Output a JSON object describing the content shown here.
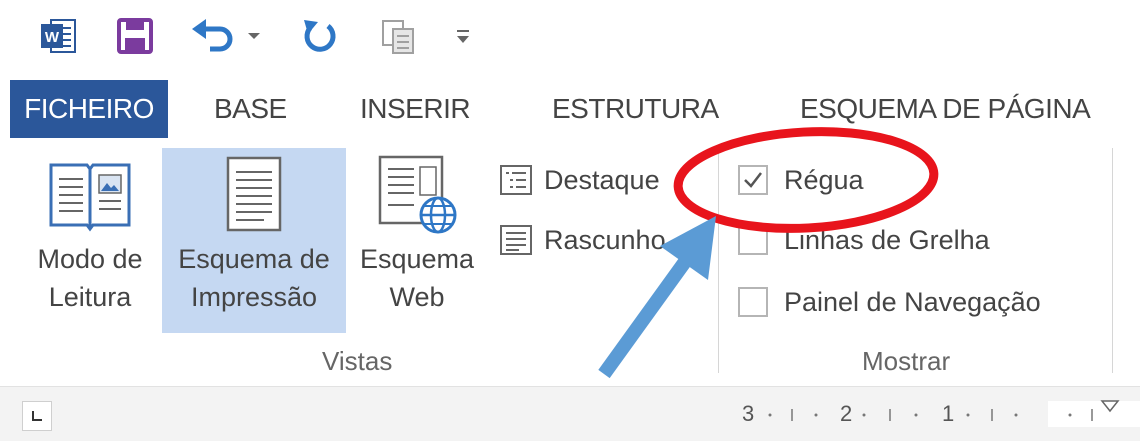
{
  "qat": {
    "icons": [
      "word-icon",
      "save-icon",
      "undo-icon",
      "undo-dropdown-icon",
      "redo-icon",
      "copy-icon",
      "customize-qat-icon"
    ]
  },
  "tabs": {
    "file": "FICHEIRO",
    "home": "BASE",
    "insert": "INSERIR",
    "design": "ESTRUTURA",
    "layout": "ESQUEMA DE PÁGINA"
  },
  "views": {
    "read_mode": {
      "line1": "Modo de",
      "line2": "Leitura"
    },
    "print_layout": {
      "line1": "Esquema de",
      "line2": "Impressão"
    },
    "web_layout": {
      "line1": "Esquema",
      "line2": "Web"
    },
    "outline": "Destaque",
    "draft": "Rascunho",
    "group_label": "Vistas"
  },
  "show": {
    "ruler": {
      "label": "Régua",
      "checked": true
    },
    "gridlines": {
      "label": "Linhas de Grelha",
      "checked": false
    },
    "nav_pane": {
      "label": "Painel de Navegação",
      "checked": false
    },
    "group_label": "Mostrar"
  },
  "ruler": {
    "numbers": [
      "3",
      "2",
      "1"
    ]
  },
  "colors": {
    "file_tab": "#2b579a",
    "selected_view": "#c5d8f2",
    "highlight_circle": "#e8141c",
    "arrow": "#5b9bd5"
  }
}
